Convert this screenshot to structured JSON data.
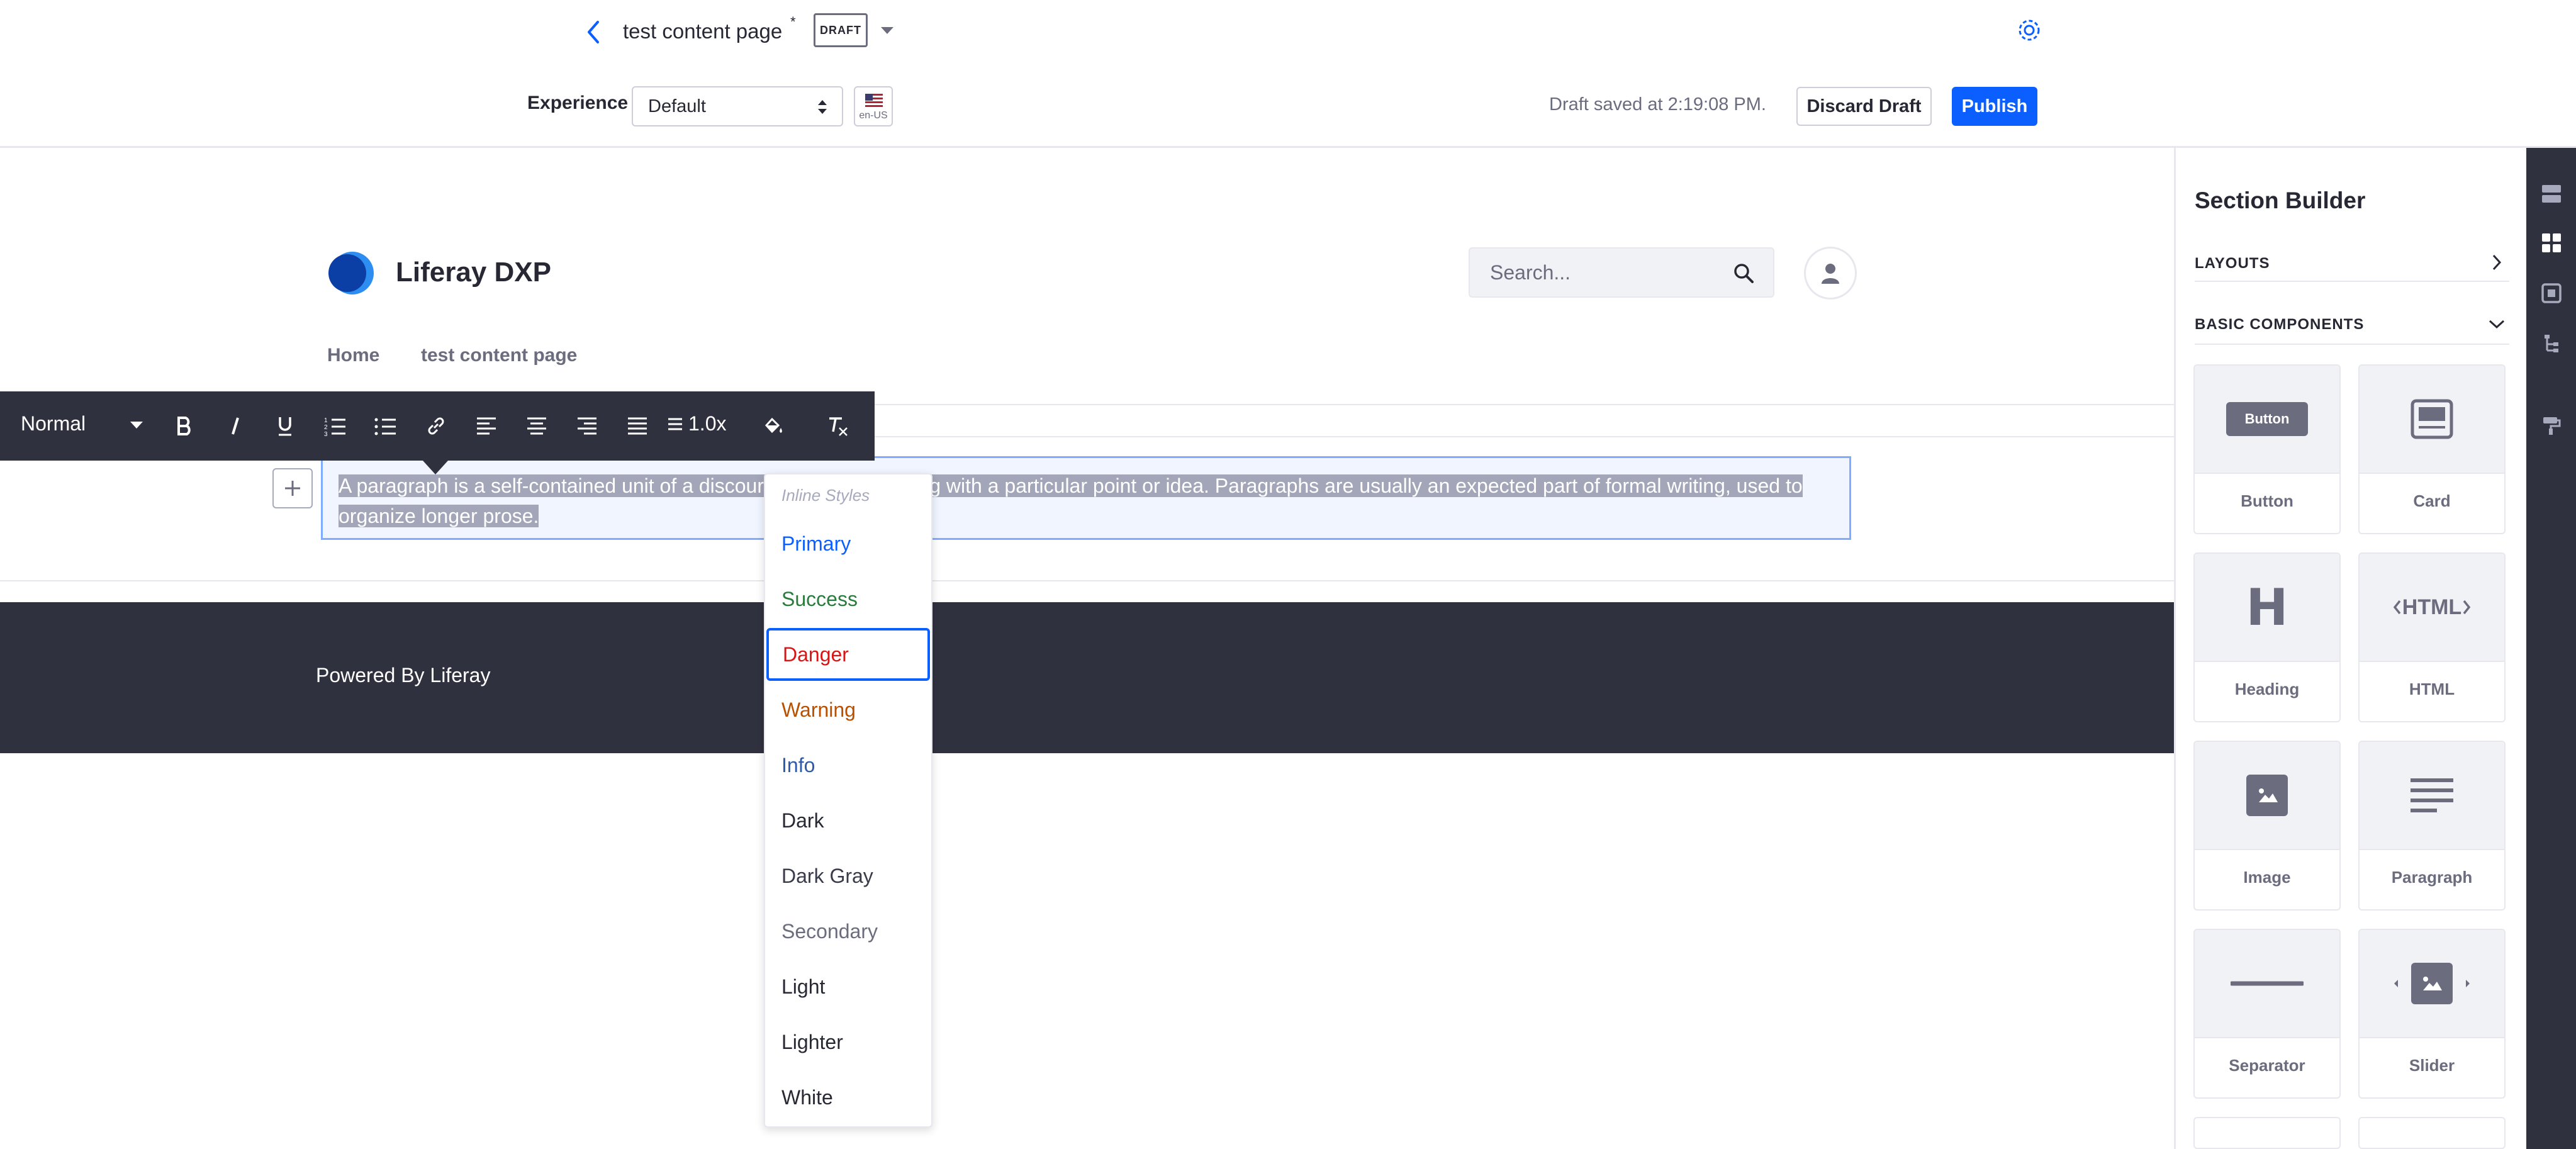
{
  "header": {
    "page_title": "test content page",
    "asterisk": "*",
    "status_badge": "DRAFT",
    "experience_label": "Experience",
    "experience_value": "Default",
    "locale": "en-US",
    "draft_saved": "Draft saved at 2:19:08 PM.",
    "discard_label": "Discard Draft",
    "publish_label": "Publish"
  },
  "site": {
    "name": "Liferay DXP",
    "search_placeholder": "Search...",
    "nav": [
      "Home",
      "test content page"
    ]
  },
  "paragraph": {
    "text": "A paragraph is a self-contained unit of a discourse in writing dealing with a particular point or idea. Paragraphs are usually an expected part of formal writing, used to organize longer prose."
  },
  "footer": {
    "text": "Powered By Liferay"
  },
  "toolbar": {
    "style_label": "Normal",
    "line_height": "1.0x",
    "buttons": [
      "bold-icon",
      "italic-icon",
      "underline-icon",
      "ordered-list-icon",
      "unordered-list-icon",
      "link-icon",
      "align-left-icon",
      "align-center-icon",
      "align-right-icon",
      "justify-icon",
      "line-height-icon",
      "text-color-icon",
      "clear-format-icon"
    ]
  },
  "inline_styles": {
    "header": "Inline Styles",
    "selected": "Danger",
    "items": [
      {
        "label": "Primary",
        "color": "#0b5fff"
      },
      {
        "label": "Success",
        "color": "#287d3c"
      },
      {
        "label": "Danger",
        "color": "#da1414"
      },
      {
        "label": "Warning",
        "color": "#b95000"
      },
      {
        "label": "Info",
        "color": "#2e5aac"
      },
      {
        "label": "Dark",
        "color": "#272833"
      },
      {
        "label": "Dark Gray",
        "color": "#393a4a"
      },
      {
        "label": "Secondary",
        "color": "#6b6c7e"
      },
      {
        "label": "Light",
        "color": "#272833"
      },
      {
        "label": "Lighter",
        "color": "#272833"
      },
      {
        "label": "White",
        "color": "#272833"
      }
    ]
  },
  "sidebar": {
    "title": "Section Builder",
    "layouts_label": "LAYOUTS",
    "basic_components_label": "BASIC COMPONENTS",
    "components": [
      {
        "label": "Button",
        "preview_text": "Button"
      },
      {
        "label": "Card"
      },
      {
        "label": "Heading",
        "preview_text": "H"
      },
      {
        "label": "HTML",
        "preview_text": "HTML"
      },
      {
        "label": "Image"
      },
      {
        "label": "Paragraph"
      },
      {
        "label": "Separator"
      },
      {
        "label": "Slider"
      }
    ]
  },
  "colors": {
    "accent": "#0b5fff",
    "dark": "#30313f",
    "border": "#e7e7ed"
  }
}
